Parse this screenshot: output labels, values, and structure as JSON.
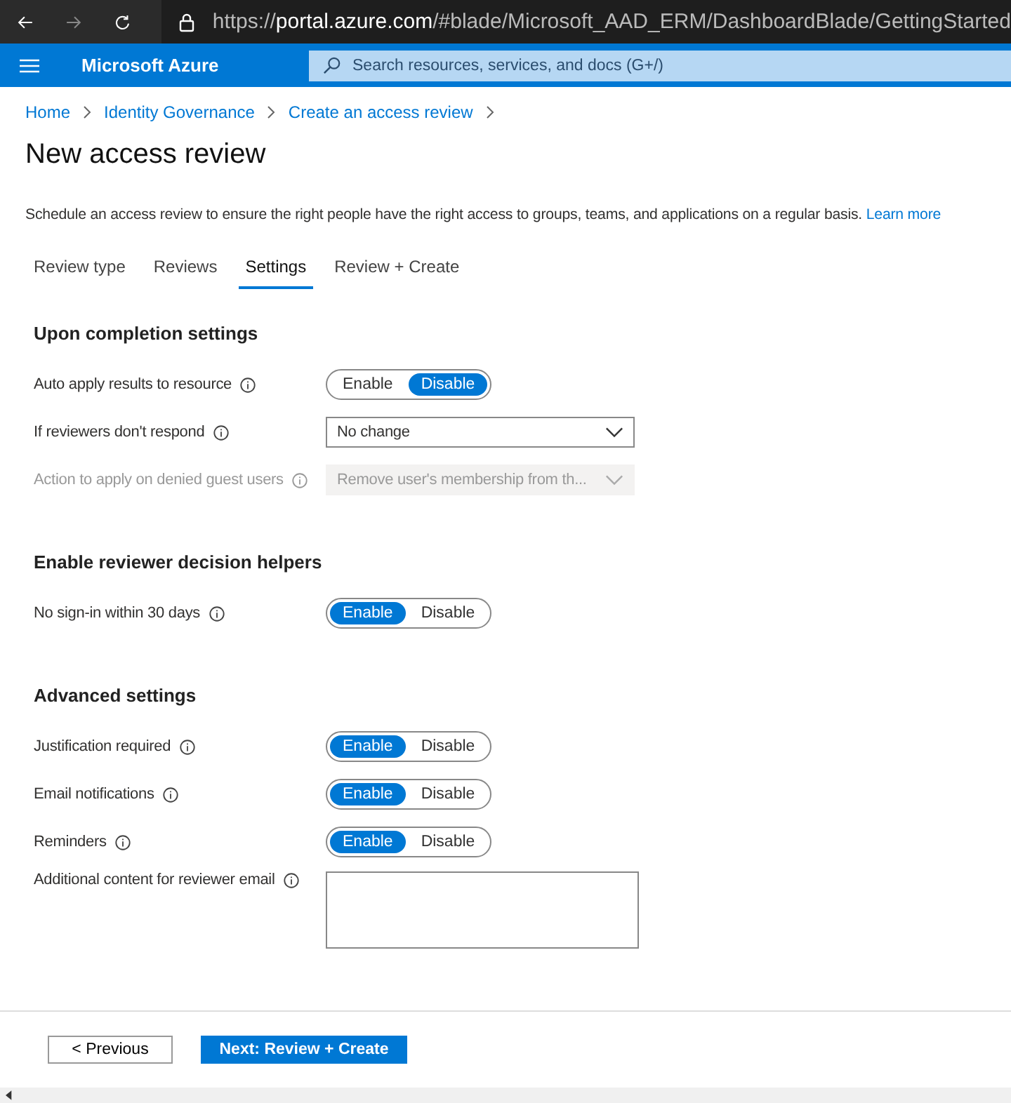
{
  "browser": {
    "url_scheme": "https://",
    "url_host": "portal.azure.com",
    "url_path": "/#blade/Microsoft_AAD_ERM/DashboardBlade/GettingStarted"
  },
  "header": {
    "brand": "Microsoft Azure",
    "search": {
      "placeholder": "Search resources, services, and docs (G+/)"
    }
  },
  "breadcrumb": [
    "Home",
    "Identity Governance",
    "Create an access review"
  ],
  "title": "New access review",
  "description": {
    "text": "Schedule an access review to ensure the right people have the right access to groups, teams, and applications on a regular basis.",
    "link": "Learn more"
  },
  "tabs": [
    {
      "label": "Review type",
      "selected": false
    },
    {
      "label": "Reviews",
      "selected": false
    },
    {
      "label": "Settings",
      "selected": true
    },
    {
      "label": "Review + Create",
      "selected": false
    }
  ],
  "sections": [
    {
      "heading": "Upon completion settings",
      "rows": [
        {
          "label": "Auto apply results to resource",
          "kind": "toggle",
          "disabled": false,
          "options": [
            {
              "label": "Enable",
              "selected": false
            },
            {
              "label": "Disable",
              "selected": true
            }
          ]
        },
        {
          "label": "If reviewers don't respond",
          "kind": "dropdown",
          "disabled": false,
          "value": "No change"
        },
        {
          "label": "Action to apply on denied guest users",
          "kind": "dropdown",
          "disabled": true,
          "value": "Remove user's membership from th..."
        }
      ]
    },
    {
      "heading": "Enable reviewer decision helpers",
      "rows": [
        {
          "label": "No sign-in within 30 days",
          "kind": "toggle",
          "disabled": false,
          "options": [
            {
              "label": "Enable",
              "selected": true
            },
            {
              "label": "Disable",
              "selected": false
            }
          ]
        }
      ]
    },
    {
      "heading": "Advanced settings",
      "rows": [
        {
          "label": "Justification required",
          "kind": "toggle",
          "disabled": false,
          "options": [
            {
              "label": "Enable",
              "selected": true
            },
            {
              "label": "Disable",
              "selected": false
            }
          ]
        },
        {
          "label": "Email notifications",
          "kind": "toggle",
          "disabled": false,
          "options": [
            {
              "label": "Enable",
              "selected": true
            },
            {
              "label": "Disable",
              "selected": false
            }
          ]
        },
        {
          "label": "Reminders",
          "kind": "toggle",
          "disabled": false,
          "options": [
            {
              "label": "Enable",
              "selected": true
            },
            {
              "label": "Disable",
              "selected": false
            }
          ]
        },
        {
          "label": "Additional content for reviewer email",
          "kind": "textarea",
          "disabled": false
        }
      ]
    }
  ],
  "footer": {
    "previous": "< Previous",
    "next": "Next: Review + Create"
  }
}
